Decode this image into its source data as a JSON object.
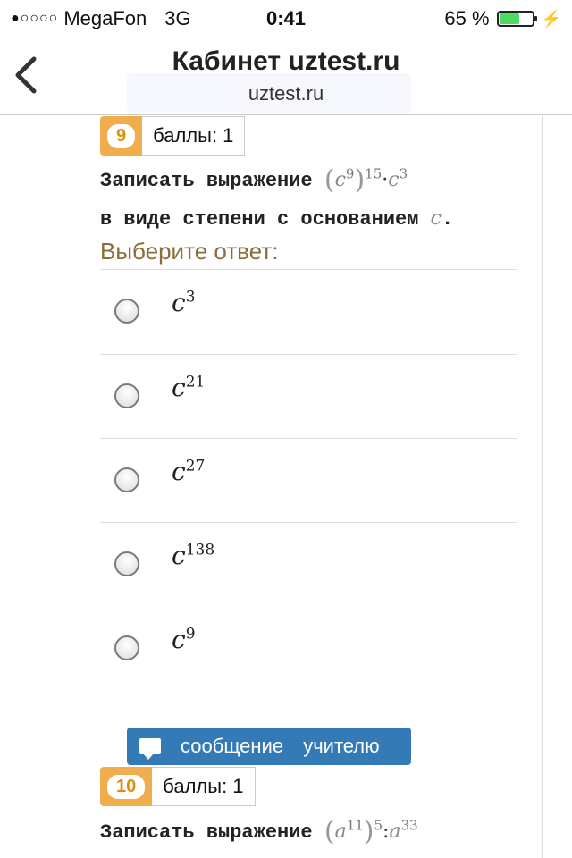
{
  "status_bar": {
    "signal": "●○○○○",
    "carrier": "MegaFon",
    "network": "3G",
    "time": "0:41",
    "battery_text": "65 %",
    "battery_level": 0.65,
    "charging_icon": "bolt-icon"
  },
  "navbar": {
    "title": "Кабинет uztest.ru",
    "subtitle": "uztest.ru",
    "back_icon": "chevron-left-icon"
  },
  "question9": {
    "number": "9",
    "score": "баллы: 1",
    "line1_text": "Записать выражение",
    "line1_math": {
      "paren_open": "(",
      "base": "c",
      "exp_inner": "9",
      "paren_close": ")",
      "exp_outer": "15",
      "dot": "·",
      "base2": "c",
      "exp2": "3"
    },
    "line2_text": "в виде степени с основанием",
    "line2_math": "c",
    "line2_end": ".",
    "prompt": "Выберите ответ:",
    "options": [
      {
        "base": "c",
        "exp": "3"
      },
      {
        "base": "c",
        "exp": "21"
      },
      {
        "base": "c",
        "exp": "27"
      },
      {
        "base": "c",
        "exp": "138"
      },
      {
        "base": "c",
        "exp": "9"
      }
    ]
  },
  "message_button": {
    "label": "сообщение учителю",
    "icon": "chat-bubble-icon"
  },
  "question10": {
    "number": "10",
    "score": "баллы: 1",
    "line1_text": "Записать выражение",
    "line1_math": {
      "paren_open": "(",
      "base": "a",
      "exp_inner": "11",
      "paren_close": ")",
      "exp_outer": "5",
      "op": ":",
      "base2": "a",
      "exp2": "33"
    }
  }
}
